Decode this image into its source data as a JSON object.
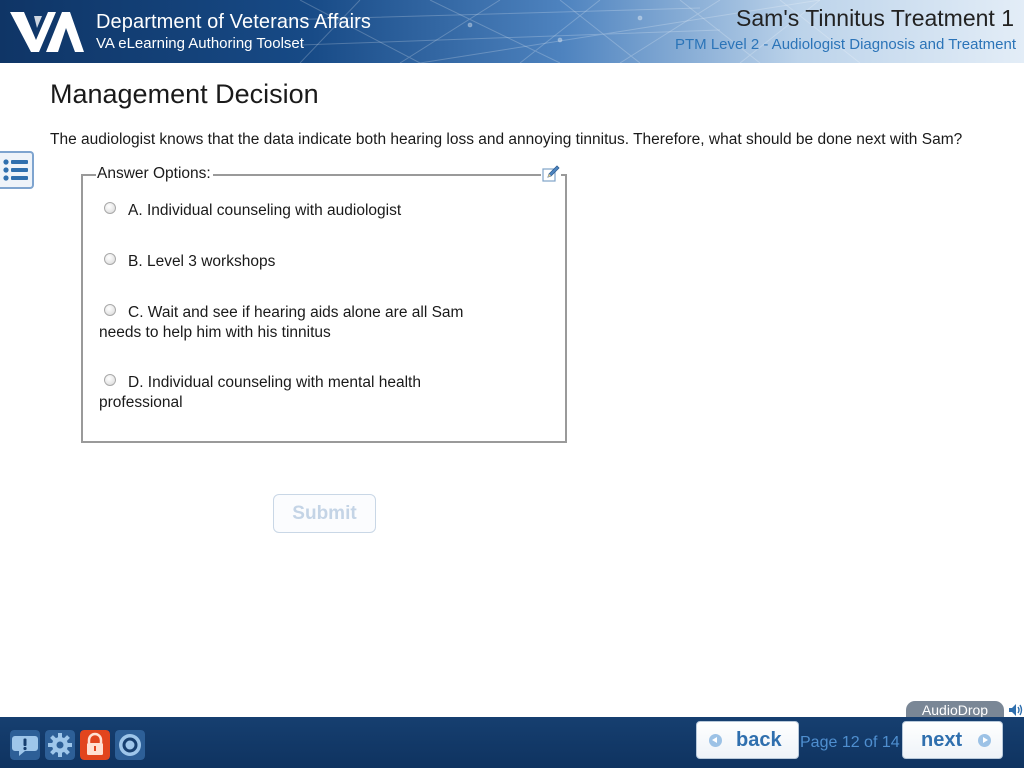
{
  "header": {
    "org_title": "Department of Veterans Affairs",
    "org_subtitle": "VA eLearning Authoring Toolset",
    "course_title": "Sam's Tinnitus Treatment 1",
    "course_subtitle": "PTM Level 2 - Audiologist Diagnosis and Treatment",
    "logo_text": "VA"
  },
  "content": {
    "heading": "Management Decision",
    "question": "The audiologist knows that the data indicate both hearing loss and annoying tinnitus. Therefore, what should be done next with Sam?",
    "answers_legend": "Answer Options:",
    "options": [
      {
        "label": "A. Individual counseling with audiologist",
        "selected": false
      },
      {
        "label": "B. Level 3 workshops",
        "selected": false
      },
      {
        "label": "C. Wait and see if hearing aids alone are all Sam needs to help him with his tinnitus",
        "selected": false
      },
      {
        "label": "D. Individual counseling with mental health professional",
        "selected": false
      }
    ],
    "submit_label": "Submit"
  },
  "footer": {
    "audiodrop_label": "AudioDrop",
    "back_label": "back",
    "next_label": "next",
    "page_indicator": "Page 12 of 14",
    "tools": [
      "help-icon",
      "settings-gear-icon",
      "lock-icon",
      "target-icon"
    ]
  },
  "colors": {
    "header_dark": "#0f3566",
    "footer_bg": "#163f70",
    "accent_blue": "#2f6fae",
    "page_indicator": "#4f8fd0"
  }
}
